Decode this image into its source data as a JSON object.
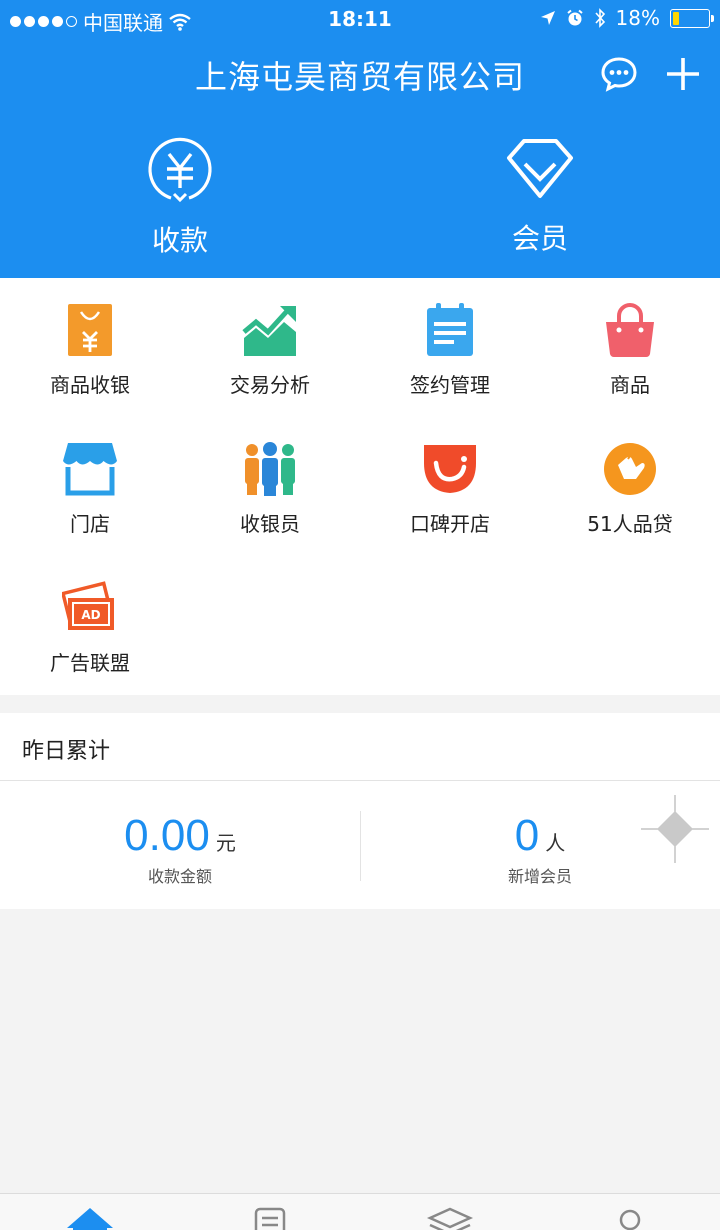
{
  "status_bar": {
    "carrier": "中国联通",
    "time": "18:11",
    "battery_percent": "18%",
    "battery_level": 0.18,
    "signal_dots_filled": 4,
    "icons": [
      "wifi-icon",
      "location-arrow-icon",
      "alarm-icon",
      "bluetooth-icon",
      "battery-icon"
    ]
  },
  "header": {
    "company_name": "上海屯昊商贸有限公司",
    "icons": [
      "chat-icon",
      "plus-icon"
    ]
  },
  "quick_actions": [
    {
      "label": "收款",
      "icon": "yuan-circle-icon"
    },
    {
      "label": "会员",
      "icon": "diamond-icon"
    }
  ],
  "apps": [
    {
      "label": "商品收银",
      "icon": "shopping-bag-yuan-icon",
      "color": "#f39a2b"
    },
    {
      "label": "交易分析",
      "icon": "trend-chart-icon",
      "color": "#2fb88a"
    },
    {
      "label": "签约管理",
      "icon": "calendar-doc-icon",
      "color": "#3aa7ee"
    },
    {
      "label": "商品",
      "icon": "basket-icon",
      "color": "#f0606b"
    },
    {
      "label": "门店",
      "icon": "storefront-icon",
      "color": "#2a9fe8"
    },
    {
      "label": "收银员",
      "icon": "people-icon",
      "color": "#f0902a"
    },
    {
      "label": "口碑开店",
      "icon": "koubei-smile-icon",
      "color": "#f04b2a"
    },
    {
      "label": "51人品贷",
      "icon": "loan-hand-icon",
      "color": "#f5961e"
    },
    {
      "label": "广告联盟",
      "icon": "ad-cards-icon",
      "color": "#f05a28"
    }
  ],
  "summary": {
    "title": "昨日累计",
    "payment_amount": "0.00",
    "payment_unit": "元",
    "payment_caption": "收款金额",
    "new_members": "0",
    "members_unit": "人",
    "members_caption": "新增会员"
  },
  "tabbar": {
    "icons": [
      "home-icon",
      "list-icon",
      "layers-icon",
      "profile-icon"
    ],
    "active_index": 0
  },
  "colors": {
    "brand_blue": "#1c8ef0",
    "background": "#f3f3f3"
  }
}
